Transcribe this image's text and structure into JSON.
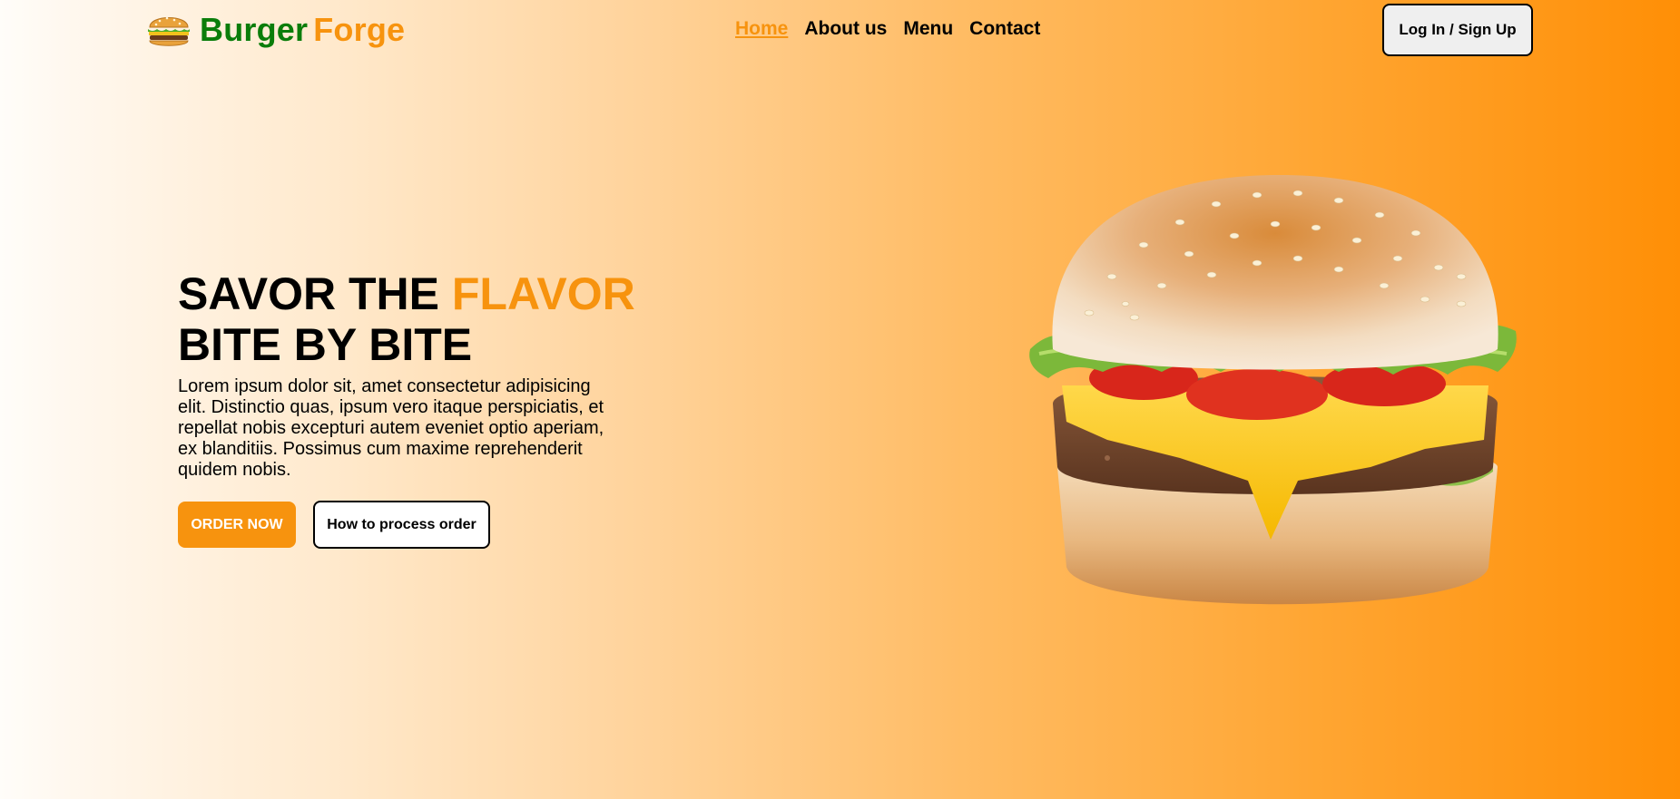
{
  "header": {
    "brand_part1": "Burger",
    "brand_part2": "Forge",
    "logo_icon": "burger-icon",
    "nav": [
      {
        "label": "Home",
        "active": true
      },
      {
        "label": "About us",
        "active": false
      },
      {
        "label": "Menu",
        "active": false
      },
      {
        "label": "Contact",
        "active": false
      }
    ],
    "login_label": "Log In / Sign Up"
  },
  "hero": {
    "title_line1_prefix": "SAVOR THE ",
    "title_line1_accent": "FLAVOR",
    "title_line2": "BITE BY BITE",
    "description": "Lorem ipsum dolor sit, amet consectetur adipisicing elit. Distinctio quas, ipsum vero itaque perspiciatis, et repellat nobis excepturi autem eveniet optio aperiam, ex blanditiis. Possimus cum maxime reprehenderit quidem nobis.",
    "order_button": "ORDER NOW",
    "how_button": "How to process order",
    "image": "cheeseburger-image"
  },
  "colors": {
    "accent": "#f7930e",
    "brand_green": "#0a7d0a",
    "gradient_end": "#ff8f06"
  }
}
